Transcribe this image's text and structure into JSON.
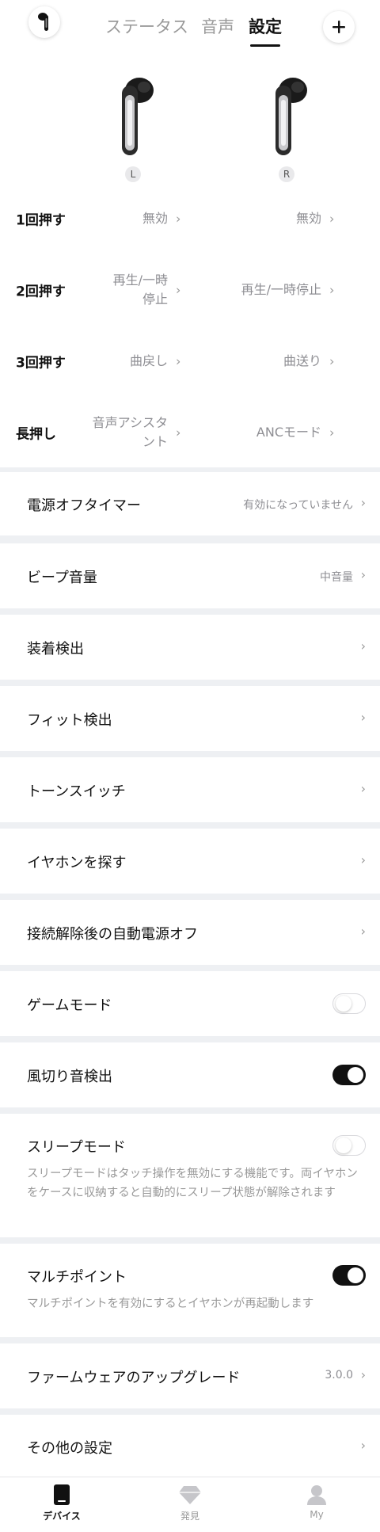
{
  "header": {
    "tabs": [
      {
        "label": "ステータス",
        "active": false
      },
      {
        "label": "音声",
        "active": false
      },
      {
        "label": "設定",
        "active": true
      }
    ],
    "earbud_icon": "earbud-icon",
    "add_icon": "plus-icon"
  },
  "earbuds": {
    "left_badge": "L",
    "right_badge": "R"
  },
  "gestures": [
    {
      "label": "1回押す",
      "left": "無効",
      "right": "無効"
    },
    {
      "label": "2回押す",
      "left": "再生/一時\n停止",
      "right": "再生/一時停止"
    },
    {
      "label": "3回押す",
      "left": "曲戻し",
      "right": "曲送り"
    },
    {
      "label": "長押し",
      "left": "音声アシスタ\nント",
      "right": "ANCモード"
    }
  ],
  "settings": {
    "power_off_timer": {
      "label": "電源オフタイマー",
      "value": "有効になっていません"
    },
    "beep_volume": {
      "label": "ビープ音量",
      "value": "中音量"
    },
    "wear_detection": {
      "label": "装着検出"
    },
    "fit_detection": {
      "label": "フィット検出"
    },
    "tone_switch": {
      "label": "トーンスイッチ"
    },
    "find_earphones": {
      "label": "イヤホンを探す"
    },
    "auto_power_off": {
      "label": "接続解除後の自動電源オフ"
    },
    "game_mode": {
      "label": "ゲームモード",
      "on": false
    },
    "wind_noise": {
      "label": "風切り音検出",
      "on": true
    },
    "sleep_mode": {
      "label": "スリープモード",
      "on": false,
      "description": "スリープモードはタッチ操作を無効にする機能です。両イヤホンをケースに収納すると自動的にスリープ状態が解除されます"
    },
    "multipoint": {
      "label": "マルチポイント",
      "on": true,
      "description": "マルチポイントを有効にするとイヤホンが再起動します"
    },
    "firmware": {
      "label": "ファームウェアのアップグレード",
      "value": "3.0.0"
    },
    "other_settings": {
      "label": "その他の設定"
    }
  },
  "chevron": "›",
  "bottom_nav": [
    {
      "label": "デバイス",
      "icon": "device-icon",
      "active": true
    },
    {
      "label": "発見",
      "icon": "diamond-icon",
      "active": false
    },
    {
      "label": "My",
      "icon": "user-icon",
      "active": false
    }
  ]
}
